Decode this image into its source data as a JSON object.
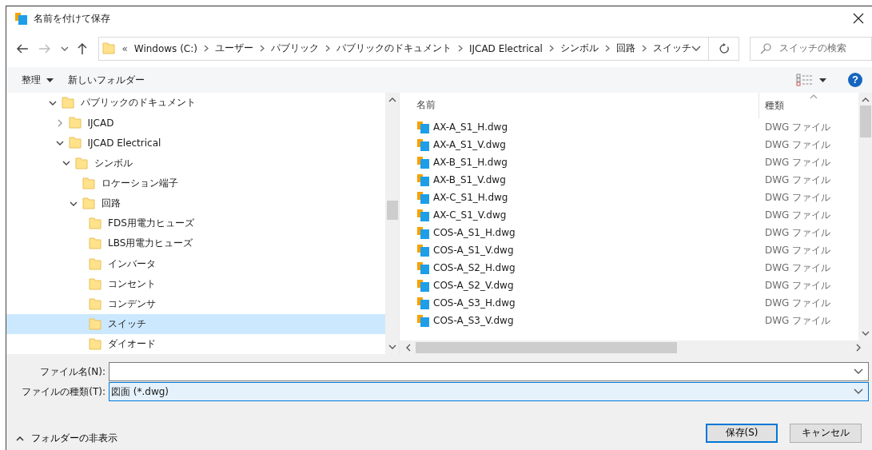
{
  "window": {
    "title": "名前を付けて保存"
  },
  "navigation": {
    "back_enabled": true,
    "forward_enabled": false,
    "overflow": "«",
    "path": [
      "Windows (C:)",
      "ユーザー",
      "パブリック",
      "パブリックのドキュメント",
      "IJCAD Electrical",
      "シンボル",
      "回路",
      "スイッチ"
    ],
    "search_placeholder": "スイッチの検索"
  },
  "toolbar": {
    "organize": "整理",
    "new_folder": "新しいフォルダー",
    "help": "?"
  },
  "tree": [
    {
      "label": "パブリックのドキュメント",
      "expanded": true,
      "selected": false,
      "children": [
        {
          "label": "IJCAD",
          "expanded": false,
          "selected": false
        },
        {
          "label": "IJCAD Electrical",
          "expanded": true,
          "selected": false,
          "children": [
            {
              "label": "シンボル",
              "expanded": true,
              "selected": false,
              "children": [
                {
                  "label": "ロケーション端子",
                  "selected": false
                },
                {
                  "label": "回路",
                  "expanded": true,
                  "selected": false,
                  "children": [
                    {
                      "label": "FDS用電力ヒューズ",
                      "selected": false
                    },
                    {
                      "label": "LBS用電力ヒューズ",
                      "selected": false
                    },
                    {
                      "label": "インバータ",
                      "selected": false
                    },
                    {
                      "label": "コンセント",
                      "selected": false
                    },
                    {
                      "label": "コンデンサ",
                      "selected": false
                    },
                    {
                      "label": "スイッチ",
                      "selected": true
                    },
                    {
                      "label": "ダイオード",
                      "selected": false
                    }
                  ]
                }
              ]
            }
          ]
        }
      ]
    }
  ],
  "file_list": {
    "columns": [
      "名前",
      "種類"
    ],
    "rows": [
      {
        "name": "AX-A_S1_H.dwg",
        "type": "DWG ファイル"
      },
      {
        "name": "AX-A_S1_V.dwg",
        "type": "DWG ファイル"
      },
      {
        "name": "AX-B_S1_H.dwg",
        "type": "DWG ファイル"
      },
      {
        "name": "AX-B_S1_V.dwg",
        "type": "DWG ファイル"
      },
      {
        "name": "AX-C_S1_H.dwg",
        "type": "DWG ファイル"
      },
      {
        "name": "AX-C_S1_V.dwg",
        "type": "DWG ファイル"
      },
      {
        "name": "COS-A_S1_H.dwg",
        "type": "DWG ファイル"
      },
      {
        "name": "COS-A_S1_V.dwg",
        "type": "DWG ファイル"
      },
      {
        "name": "COS-A_S2_H.dwg",
        "type": "DWG ファイル"
      },
      {
        "name": "COS-A_S2_V.dwg",
        "type": "DWG ファイル"
      },
      {
        "name": "COS-A_S3_H.dwg",
        "type": "DWG ファイル"
      },
      {
        "name": "COS-A_S3_V.dwg",
        "type": "DWG ファイル"
      }
    ]
  },
  "fields": [
    {
      "label": "ファイル名(N):",
      "focused": false
    },
    {
      "label": "ファイルの種類(T):",
      "value": "図面 (*.dwg)",
      "focused": true
    }
  ],
  "folder_toggle": "フォルダーの非表示",
  "buttons": [
    {
      "label": "保存(S)",
      "default": true
    },
    {
      "label": "キャンセル",
      "default": false
    }
  ]
}
